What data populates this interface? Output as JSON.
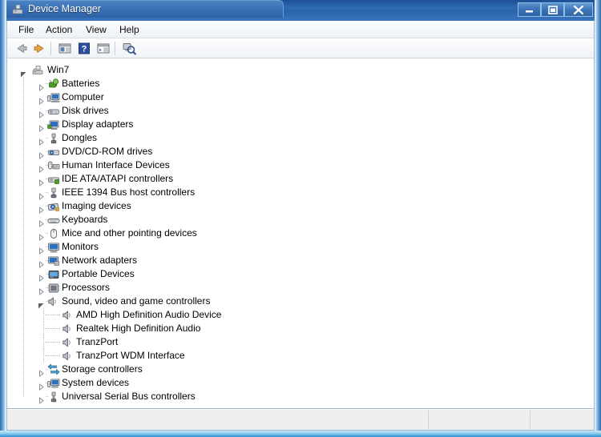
{
  "window": {
    "title": "Device Manager",
    "title_icon": "device-manager-icon",
    "controls": {
      "minimize": "Minimize",
      "maximize": "Maximize",
      "close": "Close"
    }
  },
  "menubar": {
    "items": [
      {
        "label": "File",
        "name": "menu-file"
      },
      {
        "label": "Action",
        "name": "menu-action"
      },
      {
        "label": "View",
        "name": "menu-view"
      },
      {
        "label": "Help",
        "name": "menu-help"
      }
    ]
  },
  "toolbar": {
    "buttons": [
      {
        "name": "back-button",
        "icon": "left-arrow-icon",
        "label": "Back"
      },
      {
        "name": "forward-button",
        "icon": "right-arrow-icon",
        "label": "Forward"
      },
      {
        "name": "show-console-tree-button",
        "icon": "console-tree-icon",
        "label": "Show/Hide Console Tree"
      },
      {
        "name": "help-button",
        "icon": "question-mark-icon",
        "label": "Help"
      },
      {
        "name": "properties-button",
        "icon": "properties-panel-icon",
        "label": "Properties"
      },
      {
        "name": "scan-hardware-button",
        "icon": "scan-hardware-icon",
        "label": "Scan for hardware changes"
      }
    ]
  },
  "tree": {
    "root": {
      "label": "Win7",
      "icon": "computer-node-icon",
      "expanded": true
    },
    "nodes": [
      {
        "label": "Batteries",
        "icon": "battery-icon",
        "expanded": false,
        "level": 1
      },
      {
        "label": "Computer",
        "icon": "computer-icon",
        "expanded": false,
        "level": 1
      },
      {
        "label": "Disk drives",
        "icon": "disk-drive-icon",
        "expanded": false,
        "level": 1
      },
      {
        "label": "Display adapters",
        "icon": "display-icon",
        "expanded": false,
        "level": 1
      },
      {
        "label": "Dongles",
        "icon": "usb-plug-icon",
        "expanded": false,
        "level": 1
      },
      {
        "label": "DVD/CD-ROM drives",
        "icon": "dvd-drive-icon",
        "expanded": false,
        "level": 1
      },
      {
        "label": "Human Interface Devices",
        "icon": "hid-icon",
        "expanded": false,
        "level": 1
      },
      {
        "label": "IDE ATA/ATAPI controllers",
        "icon": "ide-controller-icon",
        "expanded": false,
        "level": 1
      },
      {
        "label": "IEEE 1394 Bus host controllers",
        "icon": "firewire-icon",
        "expanded": false,
        "level": 1
      },
      {
        "label": "Imaging devices",
        "icon": "camera-icon",
        "expanded": false,
        "level": 1
      },
      {
        "label": "Keyboards",
        "icon": "keyboard-icon",
        "expanded": false,
        "level": 1
      },
      {
        "label": "Mice and other pointing devices",
        "icon": "mouse-icon",
        "expanded": false,
        "level": 1
      },
      {
        "label": "Monitors",
        "icon": "monitor-icon",
        "expanded": false,
        "level": 1
      },
      {
        "label": "Network adapters",
        "icon": "network-adapter-icon",
        "expanded": false,
        "level": 1
      },
      {
        "label": "Portable Devices",
        "icon": "portable-device-icon",
        "expanded": false,
        "level": 1
      },
      {
        "label": "Processors",
        "icon": "processor-icon",
        "expanded": false,
        "level": 1
      },
      {
        "label": "Sound, video and game controllers",
        "icon": "speaker-icon",
        "expanded": true,
        "level": 1
      },
      {
        "label": "AMD High Definition Audio Device",
        "icon": "speaker-icon",
        "expanded": null,
        "level": 2
      },
      {
        "label": "Realtek High Definition Audio",
        "icon": "speaker-icon",
        "expanded": null,
        "level": 2
      },
      {
        "label": "TranzPort",
        "icon": "speaker-icon",
        "expanded": null,
        "level": 2
      },
      {
        "label": "TranzPort WDM Interface",
        "icon": "speaker-icon",
        "expanded": null,
        "level": 2
      },
      {
        "label": "Storage controllers",
        "icon": "storage-controller-icon",
        "expanded": false,
        "level": 1
      },
      {
        "label": "System devices",
        "icon": "system-device-icon",
        "expanded": false,
        "level": 1
      },
      {
        "label": "Universal Serial Bus controllers",
        "icon": "usb-plug-icon",
        "expanded": false,
        "level": 1
      }
    ]
  },
  "statusbar": {
    "segments": [
      "",
      "",
      ""
    ]
  },
  "colors": {
    "titlebar_blue": "#2f6cb3",
    "frame_blue": "#5fb4e0",
    "tree_background": "#ffffff",
    "statusbar_background": "#f0eeee",
    "battery_green": "#5aa130",
    "screen_blue": "#3a78c8",
    "device_gray": "#8a8f96"
  }
}
